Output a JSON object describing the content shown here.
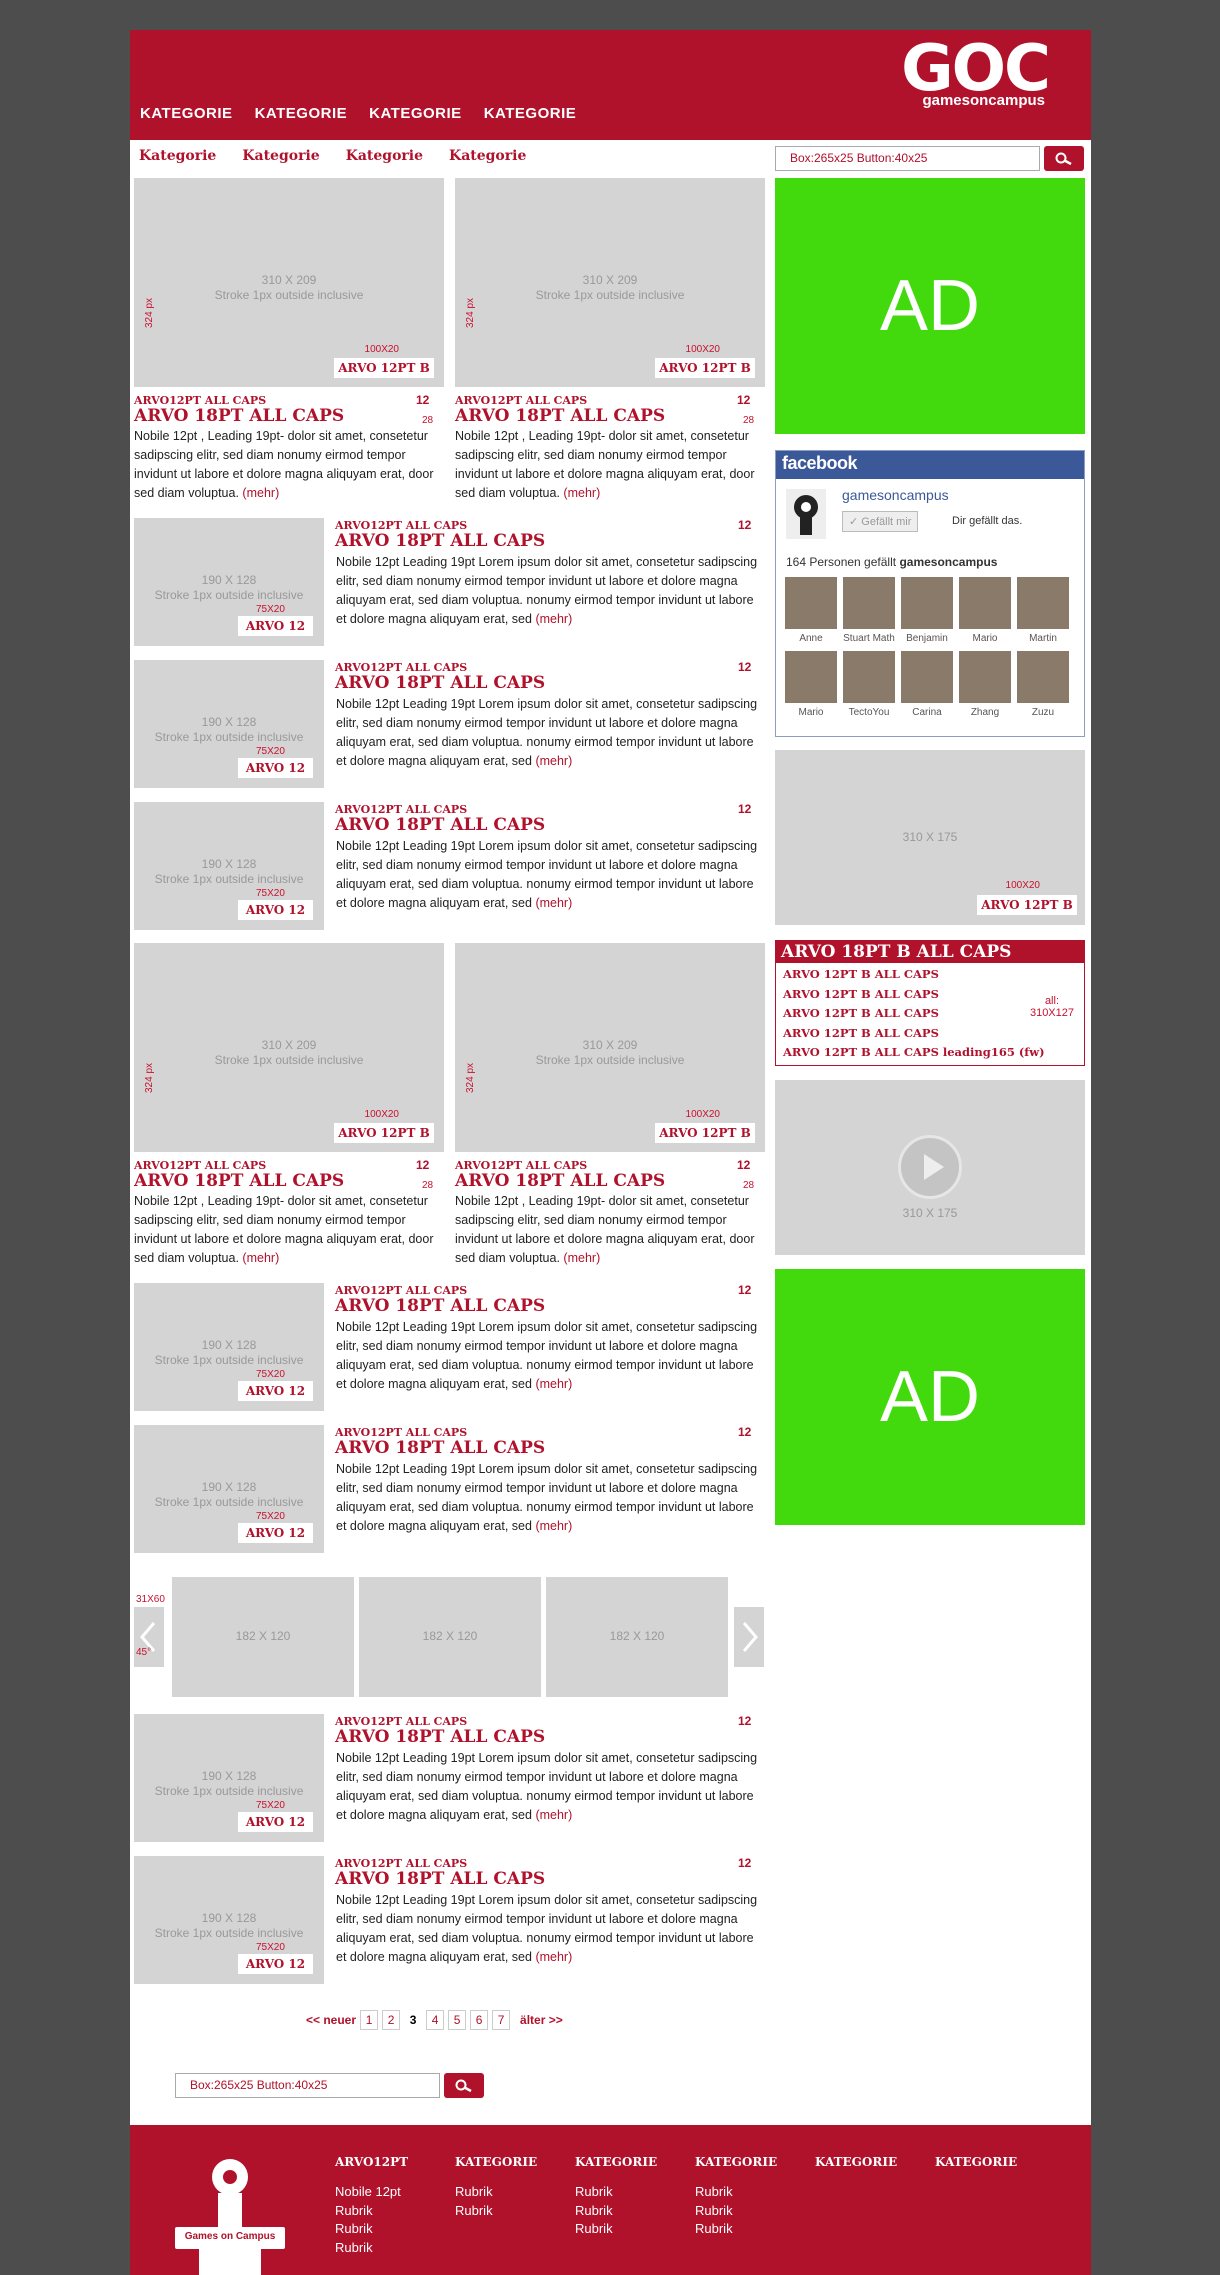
{
  "header": {
    "logo": "GOC",
    "logo_sub": "gamesoncampus",
    "nav": [
      "KATEGORIE",
      "KATEGORIE",
      "KATEGORIE",
      "KATEGORIE"
    ]
  },
  "subnav": [
    "Kategorie",
    "Kategorie",
    "Kategorie",
    "Kategorie"
  ],
  "search": {
    "label": "Box:265x25  Button:40x25"
  },
  "big_article": {
    "img_label": "310 X 209",
    "img_sub": "Stroke 1px outside inclusive",
    "badge": "ARVO 12PT B",
    "badge_dim": "100X20",
    "meta": "ARVO12PT ALL CAPS",
    "title": "ARVO 18PT ALL CAPS",
    "count": "12",
    "count_sub": "28",
    "body": "Nobile 12pt , Leading 19pt- dolor sit amet, consetetur sadipscing elitr, sed diam nonumy eirmod tempor invidunt ut labore et dolore magna aliquyam erat, door sed diam voluptua.",
    "mehr": "(mehr)",
    "height_label": "324 px"
  },
  "small_article": {
    "img_label": "190 X 128",
    "img_sub": "Stroke 1px outside inclusive",
    "badge": "ARVO 12",
    "badge_dim": "75X20",
    "meta": "ARVO12PT ALL CAPS",
    "title": "ARVO 18PT ALL CAPS",
    "count": "12",
    "body": "Nobile 12pt Leading 19pt   Lorem ipsum dolor sit amet, consetetur sadipscing elitr, sed diam nonumy eirmod tempor invidunt ut labore et dolore magna aliquyam erat, sed diam voluptua. nonumy eirmod tempor invidunt ut labore et dolore magna aliquyam erat, sed",
    "mehr": "(mehr)"
  },
  "sidebar": {
    "ad": "AD",
    "facebook": {
      "title": "facebook",
      "page": "gamesoncampus",
      "like_btn": "✓ Gefällt mir",
      "like_text": "Dir gefällt das.",
      "count_text": "164 Personen gefällt",
      "count_page": "gamesoncampus",
      "people": [
        "Anne",
        "Stuart Math",
        "Benjamin",
        "Mario",
        "Martin",
        "Mario",
        "TectoYou",
        "Carina",
        "Zhang",
        "Zuzu"
      ]
    },
    "promo": {
      "img_label": "310 X 175",
      "badge": "ARVO 12PT B",
      "badge_dim": "100X20"
    },
    "list": {
      "title": "ARVO 18PT B ALL CAPS",
      "items": [
        "ARVO 12PT B ALL CAPS",
        "ARVO 12PT B ALL CAPS",
        "ARVO 12PT B ALL CAPS",
        "ARVO 12PT B ALL CAPS",
        "ARVO 12PT B ALL CAPS leading165 (fw)"
      ],
      "note1": "all:",
      "note2": "310X127"
    },
    "video": {
      "img_label": "310 X 175"
    }
  },
  "carousel": {
    "tiles": [
      "182 X 120",
      "182 X 120",
      "182 X 120"
    ],
    "arrow_dim": "31X60",
    "angle": "45°"
  },
  "pagination": {
    "newer": "<< neuer",
    "pages": [
      "1",
      "2",
      "3",
      "4",
      "5",
      "6",
      "7"
    ],
    "older": "älter >>",
    "current": "3"
  },
  "footer": {
    "stamp": "Games on Campus",
    "cols": [
      {
        "head": "ARVO12PT",
        "items": [
          "Nobile 12pt",
          "Rubrik",
          "Rubrik",
          "Rubrik"
        ]
      },
      {
        "head": "KATEGORIE",
        "items": [
          "Rubrik",
          "Rubrik"
        ]
      },
      {
        "head": "KATEGORIE",
        "items": [
          "Rubrik",
          "Rubrik",
          "Rubrik"
        ]
      },
      {
        "head": "KATEGORIE",
        "items": [
          "Rubrik",
          "Rubrik",
          "Rubrik"
        ]
      },
      {
        "head": "KATEGORIE",
        "items": []
      },
      {
        "head": "KATEGORIE",
        "items": []
      }
    ]
  },
  "colors": {
    "brand": "#b0112b",
    "ad": "#42d90d",
    "facebook": "#3b5998"
  }
}
